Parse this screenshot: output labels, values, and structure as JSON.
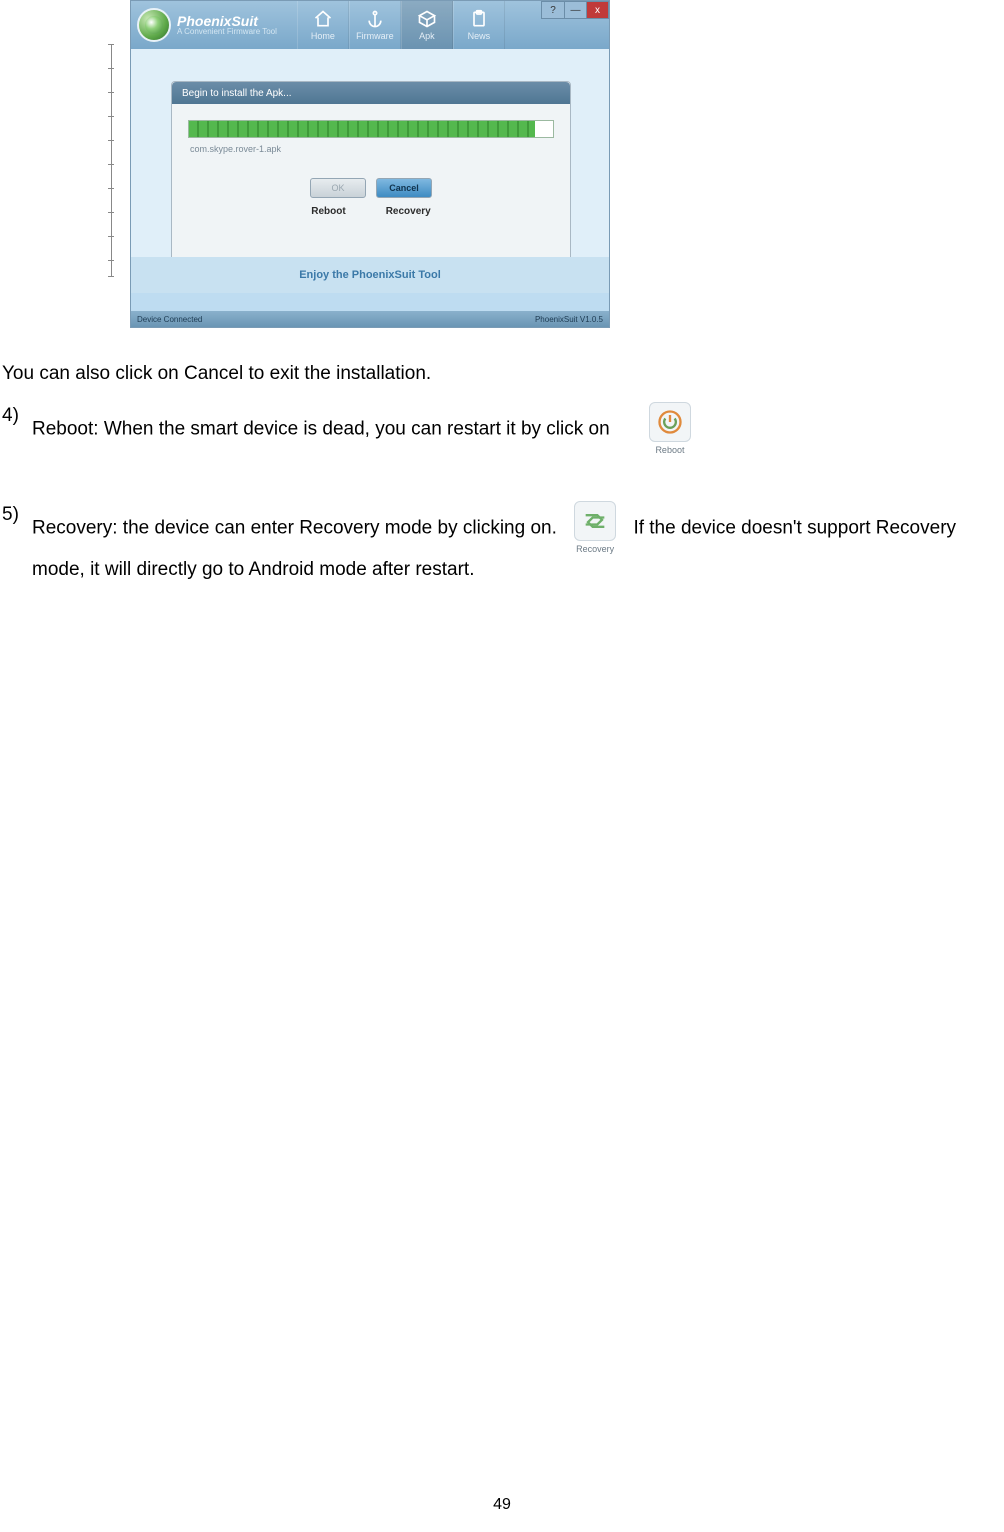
{
  "app": {
    "brand_name": "PhoenixSuit",
    "brand_sub": "A Convenient Firmware Tool",
    "titlebar": {
      "help": "?",
      "min": "—",
      "close": "x"
    },
    "tabs": [
      {
        "label": "Home",
        "icon": "home-icon",
        "active": false
      },
      {
        "label": "Firmware",
        "icon": "anchor-icon",
        "active": false
      },
      {
        "label": "Apk",
        "icon": "cube-icon",
        "active": true
      },
      {
        "label": "News",
        "icon": "clipboard-icon",
        "active": false
      }
    ],
    "modal": {
      "title": "Begin to install the Apk...",
      "apk_name": "com.skype.rover-1.apk",
      "ok_label": "OK",
      "cancel_label": "Cancel",
      "under_reboot": "Reboot",
      "under_recovery": "Recovery"
    },
    "footer_text": "Enjoy the PhoenixSuit Tool",
    "status_left": "Device Connected",
    "status_right": "PhoenixSuit V1.0.5"
  },
  "doc": {
    "p_cancel": "You can also click on Cancel to exit the installation.",
    "item4_num": "4)",
    "item4_text": "Reboot: When the smart device is dead, you can restart it by click on",
    "reboot_icon_label": "Reboot",
    "item5_num": "5)",
    "item5_text_a": "Recovery: the device can enter Recovery mode by clicking on.",
    "recovery_icon_label": "Recovery",
    "item5_text_b": "If the device doesn't support Recovery mode, it will directly go to Android mode after restart.",
    "page_number": "49"
  }
}
